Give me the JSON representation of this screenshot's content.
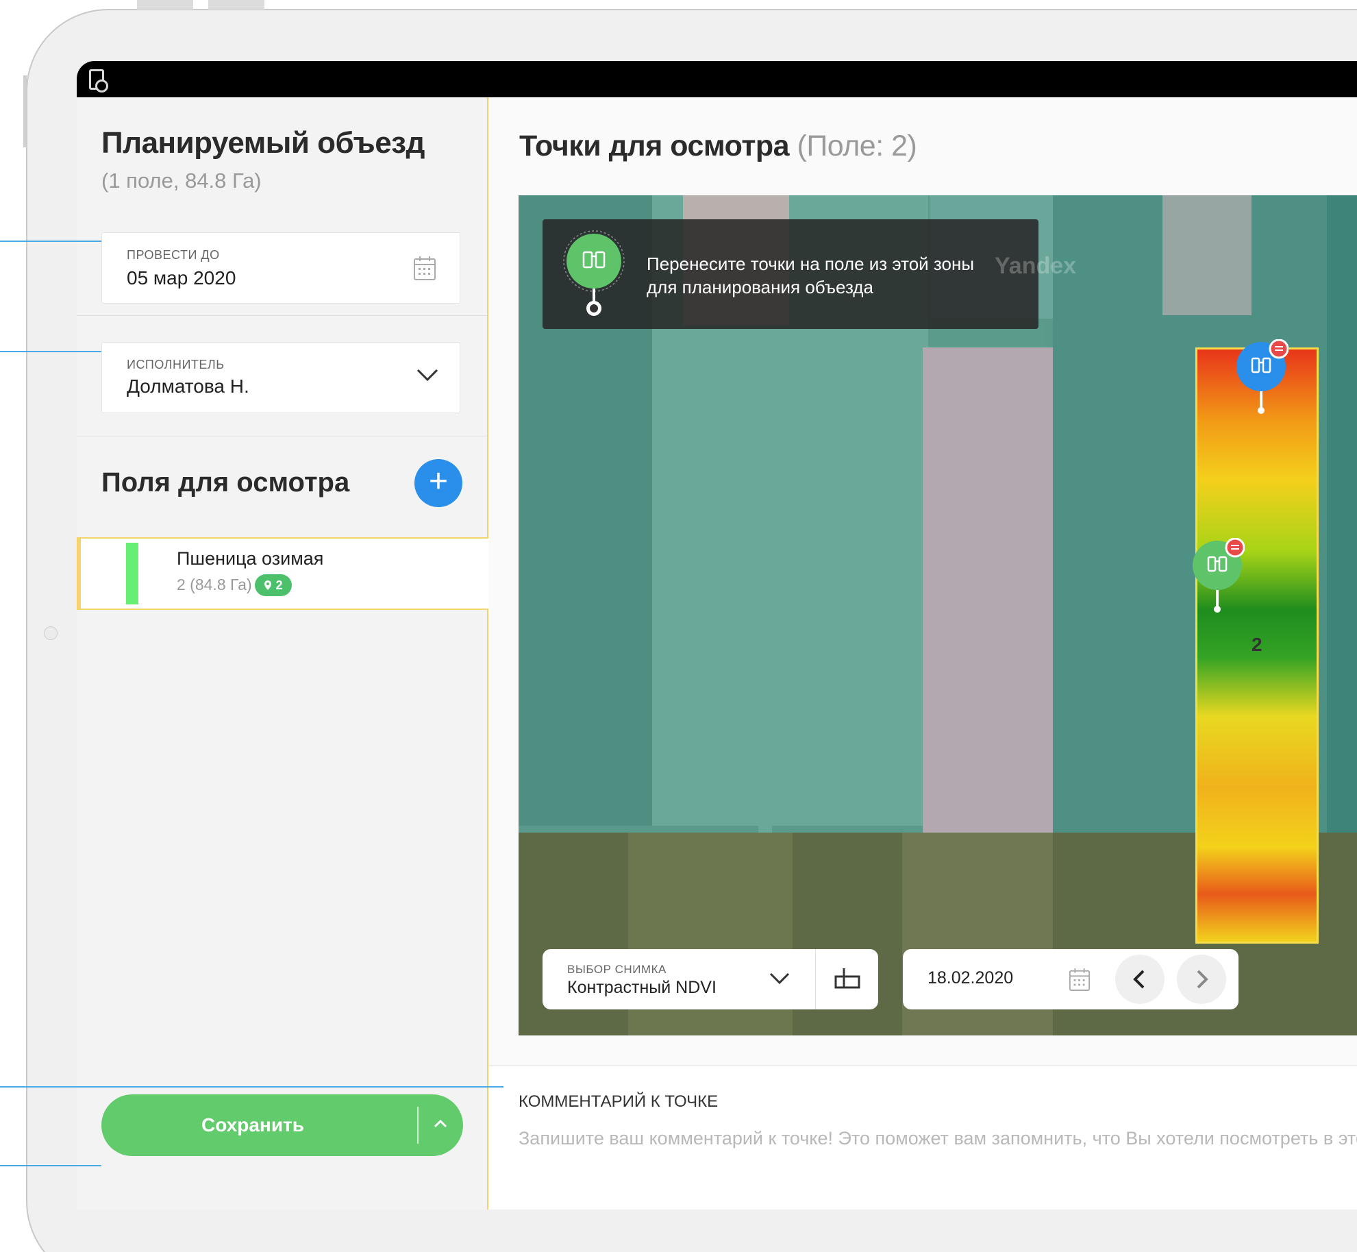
{
  "sidebar": {
    "title": "Планируемый объезд",
    "subtitle": "(1 поле, 84.8 Га)",
    "deadline": {
      "label": "ПРОВЕСТИ ДО",
      "value": "05 мар 2020"
    },
    "assignee": {
      "label": "ИСПОЛНИТЕЛЬ",
      "value": "Долматова Н."
    },
    "fields_heading": "Поля для осмотра",
    "fields": [
      {
        "name": "Пшеница озимая",
        "meta": "2 (84.8 Га)",
        "points": "2",
        "color": "#67ee74"
      }
    ],
    "save_label": "Сохранить"
  },
  "main": {
    "title": "Точки для осмотра",
    "title_suffix": "(Поле: 2)",
    "hint_text": "Перенесите точки на поле из этой зоны для планирования объезда",
    "map_watermark": "Yandex",
    "field_number": "2",
    "layer": {
      "label": "ВЫБОР СНИМКА",
      "value": "Контрастный NDVI"
    },
    "date": "18.02.2020",
    "comment": {
      "label": "КОММЕНТАРИЙ К ТОЧКЕ",
      "placeholder": "Запишите ваш комментарий к точке! Это поможет вам запомнить, что Вы хотели посмотреть в этой т"
    }
  },
  "colors": {
    "accent_blue": "#2a8fea",
    "accent_green": "#62cb6b",
    "selection_yellow": "#f2d46b"
  }
}
